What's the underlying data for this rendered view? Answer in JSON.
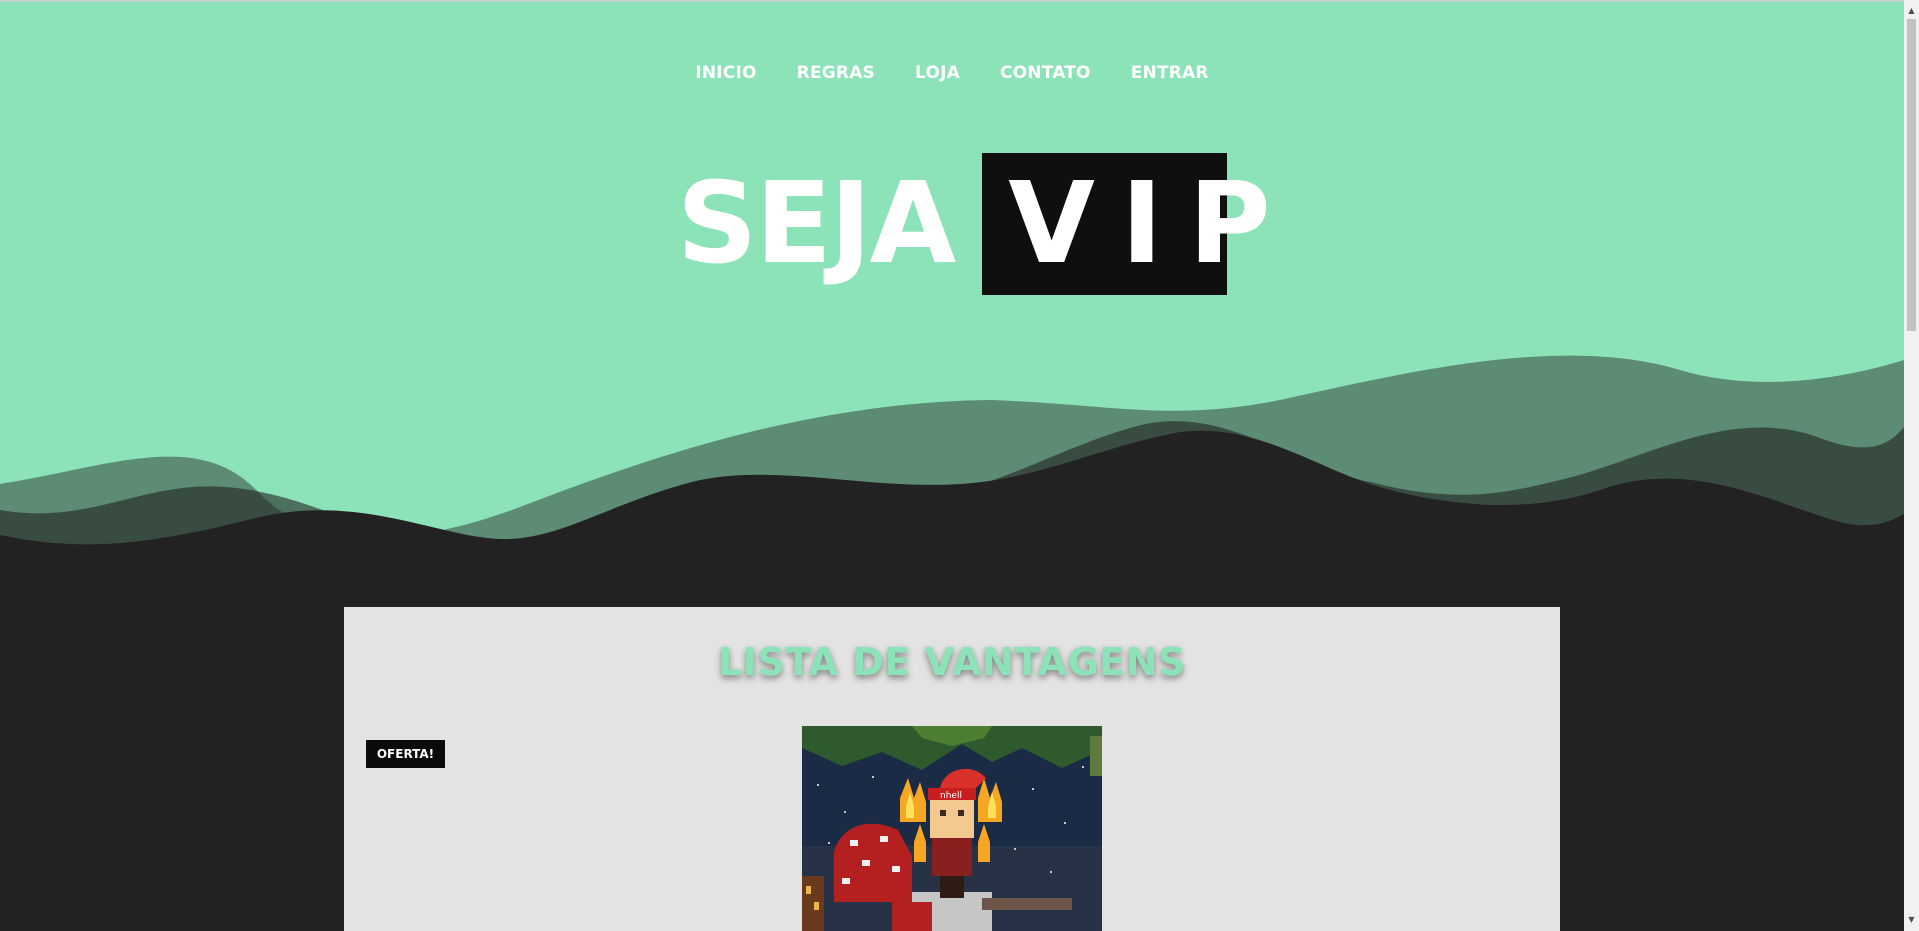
{
  "nav": {
    "items": [
      {
        "label": "INICIO"
      },
      {
        "label": "REGRAS"
      },
      {
        "label": "LOJA"
      },
      {
        "label": "CONTATO"
      },
      {
        "label": "ENTRAR"
      }
    ]
  },
  "hero": {
    "title_plain": "SEJA",
    "title_highlight": "VIP"
  },
  "content": {
    "section_title": "LISTA DE VANTAGENS",
    "badge": "OFERTA!",
    "product_image_text": "nhell"
  },
  "colors": {
    "accent": "#8ce3b8",
    "background_dark": "#222222",
    "card_background": "#e3e3e3",
    "badge_background": "#0a0a0a"
  },
  "icons": {
    "scroll_up": "triangle-up-icon",
    "scroll_down": "triangle-down-icon"
  }
}
